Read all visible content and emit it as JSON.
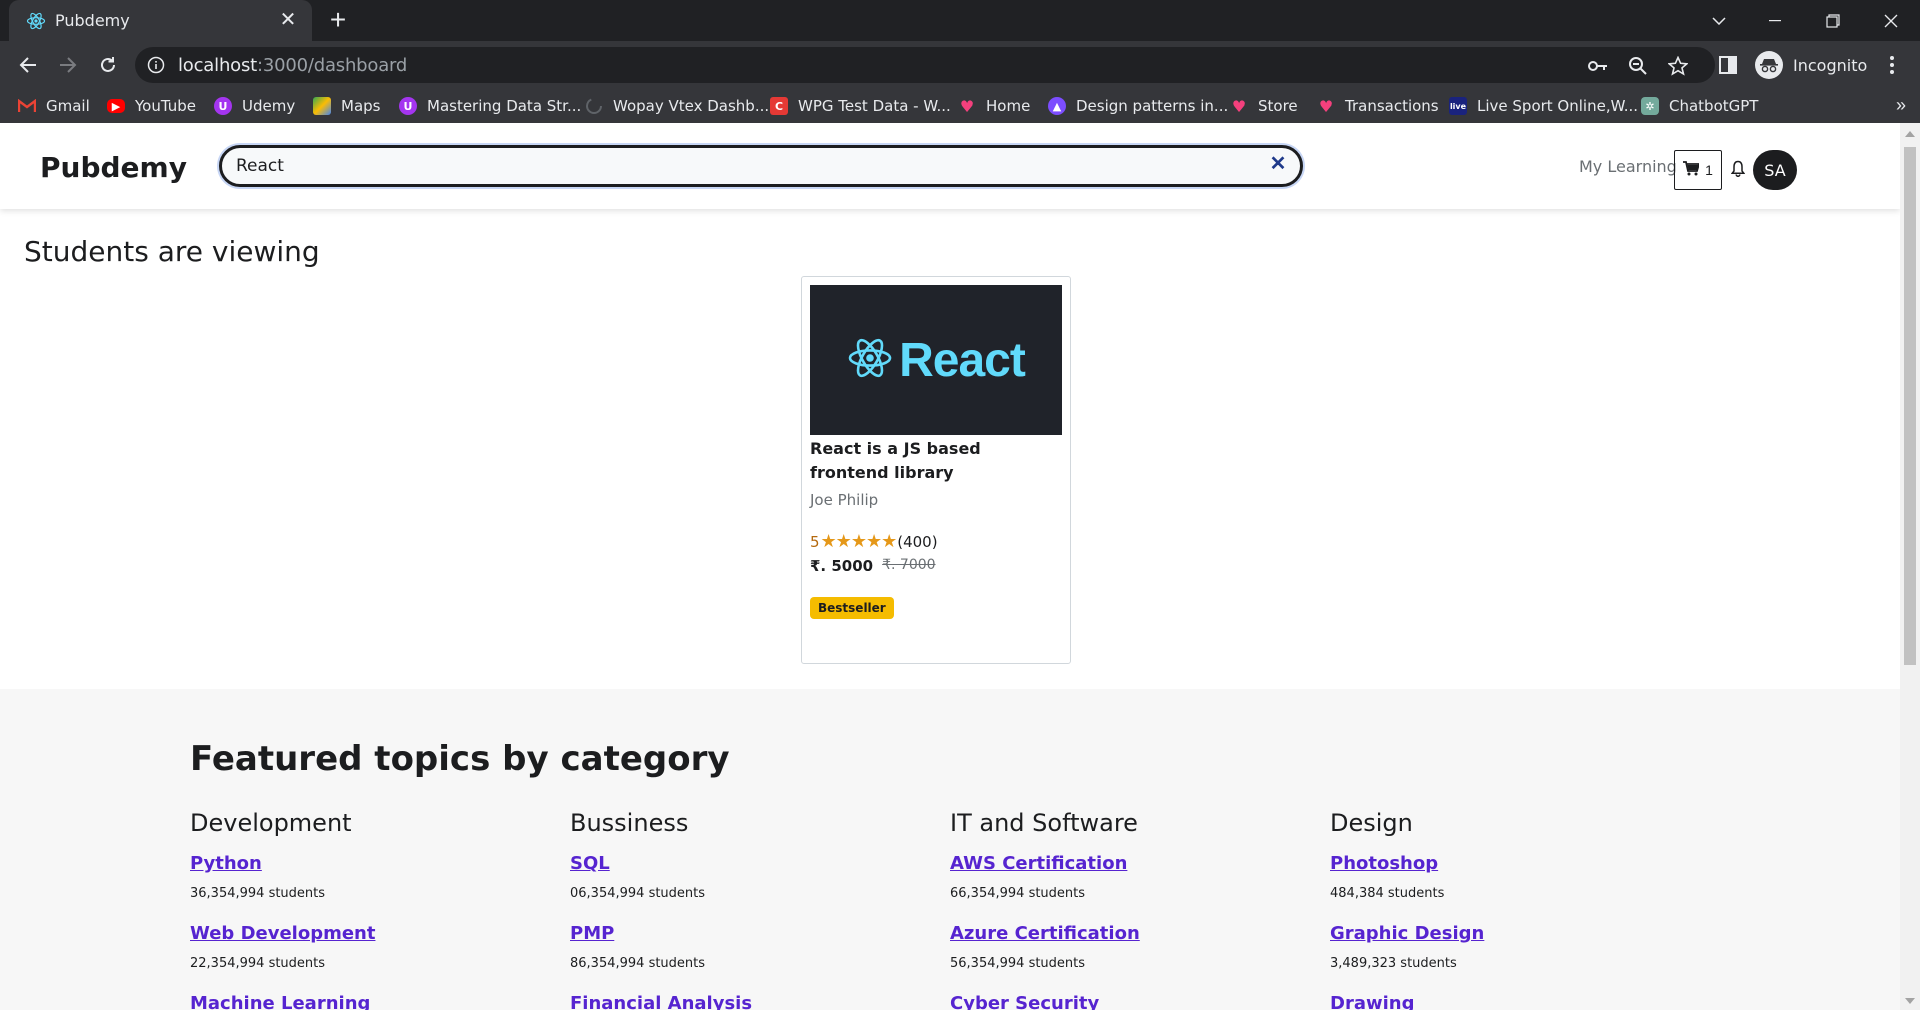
{
  "browser": {
    "tab_title": "Pubdemy",
    "url_host": "localhost",
    "url_path": ":3000/dashboard",
    "profile_label": "Incognito",
    "bookmarks": [
      {
        "label": "Gmail",
        "icon": "gmail-icon",
        "color": "#ea4335"
      },
      {
        "label": "YouTube",
        "icon": "youtube-icon",
        "color": "#ff0000"
      },
      {
        "label": "Udemy",
        "icon": "udemy-icon",
        "color": "#a435f0"
      },
      {
        "label": "Maps",
        "icon": "maps-icon",
        "color": "#34a853"
      },
      {
        "label": "Mastering Data Str...",
        "icon": "udemy-icon",
        "color": "#a435f0"
      },
      {
        "label": "Wopay Vtex Dashb...",
        "icon": "loading-icon",
        "color": "#5f6368"
      },
      {
        "label": "WPG Test Data - W...",
        "icon": "c-icon",
        "color": "#e53935"
      },
      {
        "label": "Home",
        "icon": "heart-icon",
        "color": "#f4407d"
      },
      {
        "label": "Design patterns in...",
        "icon": "rocket-icon",
        "color": "#7c4dff"
      },
      {
        "label": "Store",
        "icon": "heart-icon",
        "color": "#f4407d"
      },
      {
        "label": "Transactions",
        "icon": "heart-icon",
        "color": "#f4407d"
      },
      {
        "label": "Live Sport Online,W...",
        "icon": "live-icon",
        "color": "#1a237e"
      },
      {
        "label": "ChatbotGPT",
        "icon": "chatgpt-icon",
        "color": "#74aa9c"
      }
    ],
    "more_bookmarks": "»"
  },
  "header": {
    "brand": "Pubdemy",
    "search_value": "React",
    "my_learning": "My Learning",
    "cart_count": "1",
    "avatar_initials": "SA"
  },
  "viewing": {
    "title": "Students are viewing",
    "course": {
      "image_word": "React",
      "title": "React is a JS based frontend library",
      "author": "Joe Philip",
      "rating": "5",
      "stars": "★★★★★",
      "reviews": "(400)",
      "price": "₹. 5000",
      "old_price": "₹. 7000",
      "badge": "Bestseller"
    }
  },
  "featured": {
    "title": "Featured topics by category",
    "categories": [
      {
        "name": "Development",
        "topics": [
          {
            "label": "Python",
            "students": "36,354,994 students"
          },
          {
            "label": "Web Development",
            "students": "22,354,994 students"
          },
          {
            "label": "Machine Learning",
            "students": ""
          }
        ]
      },
      {
        "name": "Bussiness",
        "topics": [
          {
            "label": "SQL",
            "students": "06,354,994 students"
          },
          {
            "label": "PMP",
            "students": "86,354,994 students"
          },
          {
            "label": "Financial Analysis",
            "students": ""
          }
        ]
      },
      {
        "name": "IT and Software",
        "topics": [
          {
            "label": "AWS Certification",
            "students": "66,354,994 students"
          },
          {
            "label": "Azure Certification",
            "students": "56,354,994 students"
          },
          {
            "label": "Cyber Security",
            "students": ""
          }
        ]
      },
      {
        "name": "Design",
        "topics": [
          {
            "label": "Photoshop",
            "students": "484,384 students"
          },
          {
            "label": "Graphic Design",
            "students": "3,489,323 students"
          },
          {
            "label": "Drawing",
            "students": ""
          }
        ]
      }
    ]
  },
  "colors": {
    "link": "#5624d0",
    "react_cyan": "#61dafb",
    "badge": "#f5bc00",
    "rating": "#e59819"
  }
}
